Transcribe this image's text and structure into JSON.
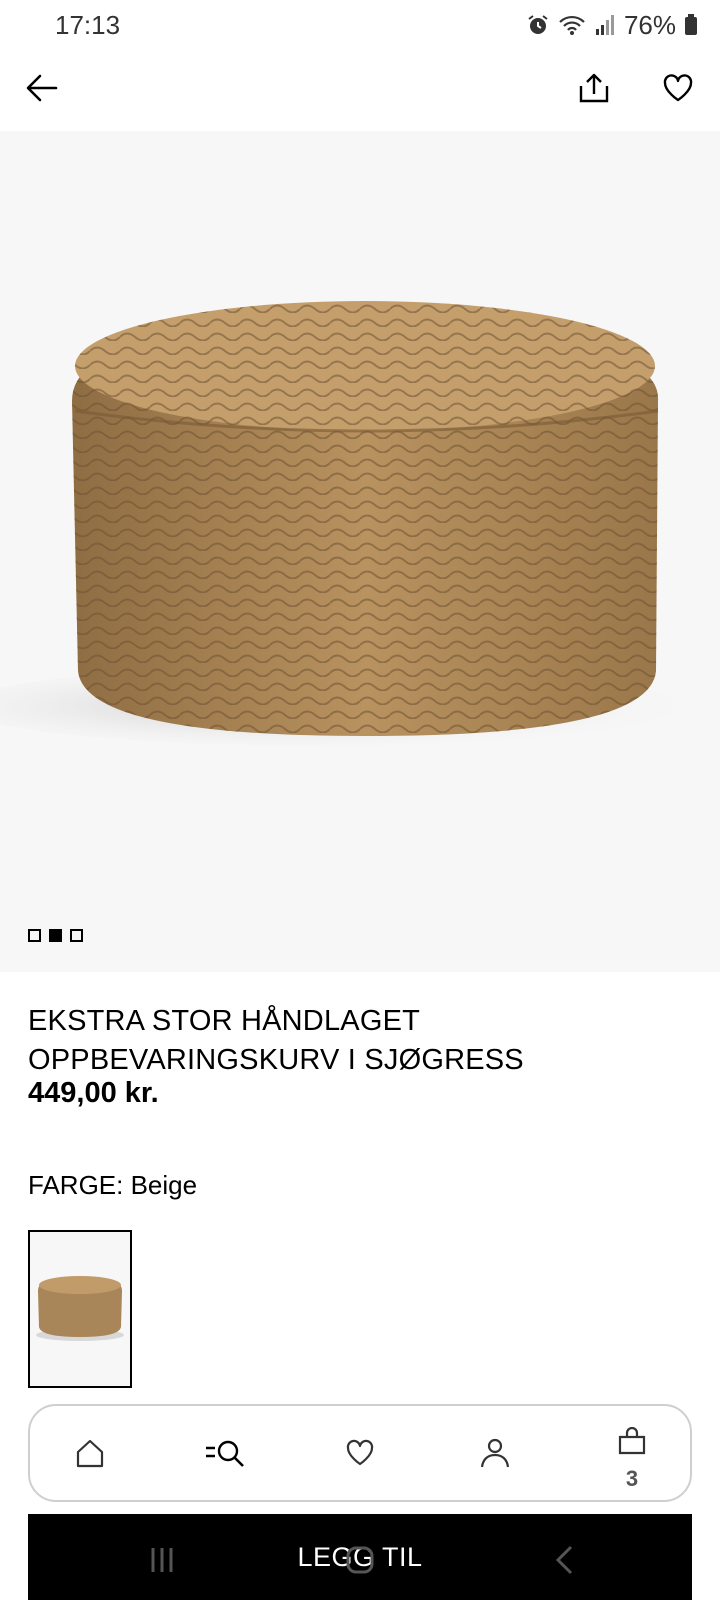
{
  "status_bar": {
    "time": "17:13",
    "battery": "76%",
    "icons": [
      "alarm-icon",
      "wifi-icon",
      "signal-icon",
      "battery-icon"
    ]
  },
  "top_bar": {
    "icons": [
      "back-arrow-icon",
      "share-icon",
      "heart-icon"
    ]
  },
  "gallery": {
    "pages": 3,
    "active_page": 2
  },
  "product": {
    "title_line1": "EKSTRA STOR HÅNDLAGET",
    "title_line2": "OPPBEVARINGSKURV I SJØGRESS",
    "price": "449,00 kr.",
    "color_label": "FARGE: Beige"
  },
  "bottom_nav": {
    "items": [
      "home-icon",
      "search-icon",
      "heart-icon",
      "account-icon",
      "bag-icon"
    ],
    "bag_count": "3"
  },
  "add_button": {
    "label": "LEGG TIL"
  },
  "colors": {
    "primary": "#000000",
    "image_bg": "#f7f7f7",
    "basket": "#b08a5a"
  }
}
